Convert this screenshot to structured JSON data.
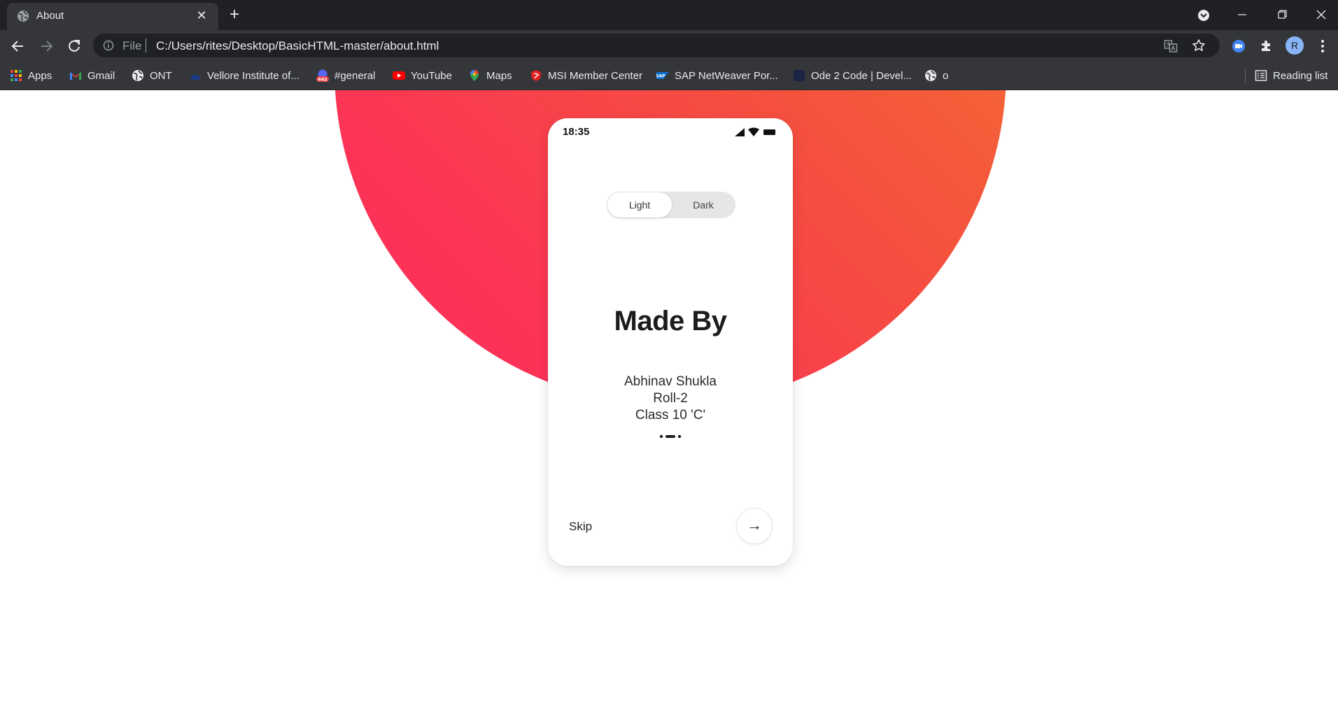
{
  "browser": {
    "tab_title": "About",
    "tab_close": "✕",
    "new_tab": "+",
    "address_prefix": "File",
    "url": "C:/Users/rites/Desktop/BasicHTML-master/about.html",
    "profile_initial": "R"
  },
  "bookmarks": [
    {
      "label": "Apps",
      "icon": "apps-grid-icon"
    },
    {
      "label": "Gmail",
      "icon": "gmail-icon"
    },
    {
      "label": "ONT",
      "icon": "globe-icon"
    },
    {
      "label": "Vellore Institute of...",
      "icon": "vit-icon"
    },
    {
      "label": "#general",
      "icon": "slack-badge-icon",
      "badge": "642"
    },
    {
      "label": "YouTube",
      "icon": "youtube-icon"
    },
    {
      "label": "Maps",
      "icon": "maps-pin-icon"
    },
    {
      "label": "MSI Member Center",
      "icon": "msi-shield-icon"
    },
    {
      "label": "SAP NetWeaver Por...",
      "icon": "sap-icon"
    },
    {
      "label": "Ode 2 Code | Devel...",
      "icon": "ode2code-icon"
    },
    {
      "label": "o",
      "icon": "globe-icon"
    }
  ],
  "reading_list": "Reading list",
  "phone": {
    "status_time": "18:35",
    "toggle": {
      "light": "Light",
      "dark": "Dark",
      "selected": "Light"
    },
    "heading": "Made By",
    "name": "Abhinav Shukla",
    "roll": "Roll-2",
    "class": "Class 10 'C'",
    "pager": {
      "count": 3,
      "active": 1
    },
    "skip": "Skip",
    "next_arrow": "→"
  },
  "colors": {
    "gradient_start": "#f27a2a",
    "gradient_end": "#ff2d5f",
    "chrome_dark": "#202124",
    "chrome_toolbar": "#35363a"
  }
}
